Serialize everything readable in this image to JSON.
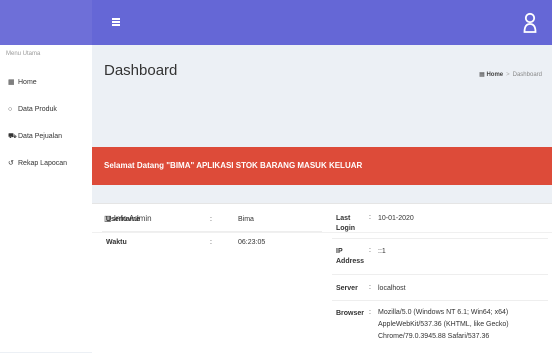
{
  "topbar": {
    "menu_icon": "hamburger-icon",
    "user_icon": "user-icon",
    "colors": {
      "brand": "#6e6fd8",
      "navbar": "#6567d6"
    }
  },
  "sidebar": {
    "header": "Menu Utama",
    "items": [
      {
        "label": "Home",
        "icon": "dashboard-icon"
      },
      {
        "label": "Data Produk",
        "icon": "circle-icon"
      },
      {
        "label": "Data Pejualan",
        "icon": "cart-icon"
      },
      {
        "label": "Rekap Lapocan",
        "icon": "history-icon"
      }
    ]
  },
  "header": {
    "title": "Dashboard",
    "breadcrumb": {
      "home": "Home",
      "current": "Dashboard"
    }
  },
  "alert": {
    "text": "Selamat Datang \"BIMA\" APLIKASI STOK BARANG MASUK KELUAR",
    "color": "#dd4b39"
  },
  "info_box": {
    "title": "Info Admin",
    "left": [
      {
        "label": "Username",
        "value": "Bima"
      },
      {
        "label": "Waktu",
        "value": "06:23:05"
      }
    ],
    "right": [
      {
        "label": "Last Login",
        "value": "10-01-2020"
      },
      {
        "label": "IP Address",
        "value": "::1"
      },
      {
        "label": "Server",
        "value": "localhost"
      },
      {
        "label": "Browser",
        "value": "Mozilla/5.0 (Windows NT 6.1; Win64; x64) AppleWebKit/537.36 (KHTML, like Gecko) Chrome/79.0.3945.88 Safari/537.36"
      }
    ]
  }
}
